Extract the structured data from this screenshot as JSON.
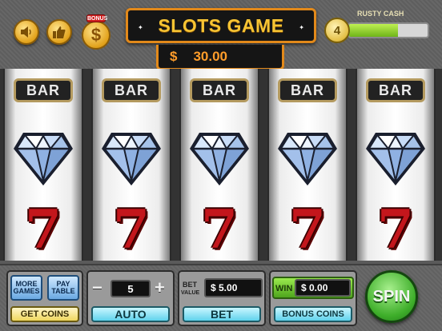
{
  "header": {
    "title": "SLOTS GAME",
    "balance_currency": "$",
    "balance_amount": "30.00",
    "bonus_tag": "BONUS",
    "bonus_symbol": "$",
    "sound_icon": "speaker-icon",
    "like_icon": "thumbs-up-icon"
  },
  "player": {
    "level": "4",
    "rank": "RUSTY CASH",
    "xp_progress": 0.62
  },
  "reels": [
    {
      "symbols": [
        "BAR",
        "diamond",
        "7"
      ]
    },
    {
      "symbols": [
        "BAR",
        "diamond",
        "7"
      ]
    },
    {
      "symbols": [
        "BAR",
        "diamond",
        "7"
      ]
    },
    {
      "symbols": [
        "BAR",
        "diamond",
        "7"
      ]
    },
    {
      "symbols": [
        "BAR",
        "diamond",
        "7"
      ]
    }
  ],
  "controls": {
    "more_games": "MORE GAMES",
    "pay_table": "PAY TABLE",
    "get_coins": "GET COINS",
    "lines_minus": "−",
    "lines_value": "5",
    "lines_plus": "+",
    "auto": "AUTO",
    "bet_label": "BET",
    "bet_value_label": "VALUE",
    "bet_value": "$ 5.00",
    "bet": "BET",
    "win_label": "WIN",
    "win_value": "$ 0.00",
    "bonus_coins": "BONUS COINS",
    "spin": "SPIN"
  },
  "colors": {
    "accent": "#e2891a",
    "title_text": "#f7c433",
    "balance_text": "#ff9d2a",
    "seven_red": "#c3161c",
    "spin_green": "#3eae2a"
  }
}
